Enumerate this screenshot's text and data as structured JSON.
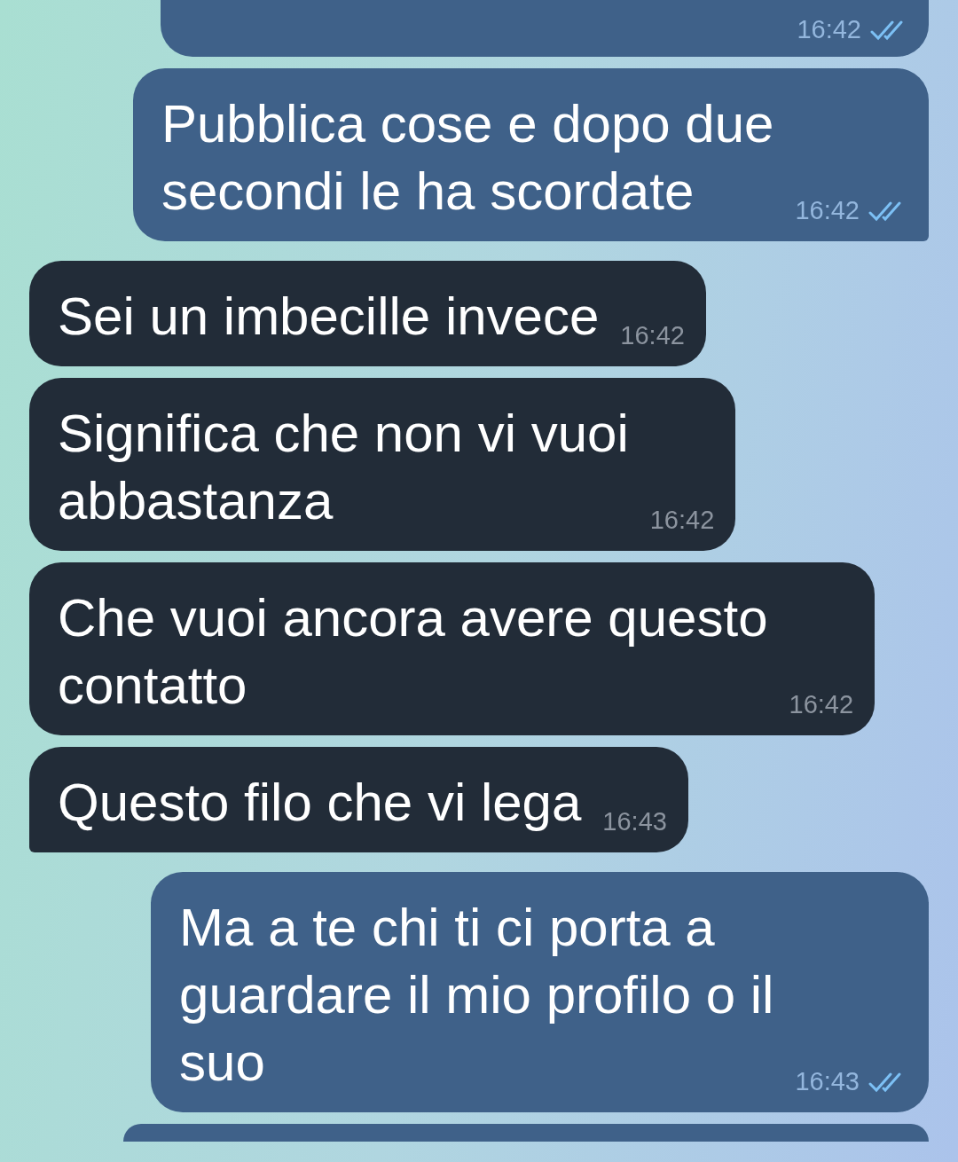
{
  "messages": [
    {
      "kind": "outgoing",
      "clipped_top": true,
      "time": "16:42",
      "read": true
    },
    {
      "kind": "outgoing",
      "lines": [
        "Pubblica cose e dopo due",
        "secondi le ha scordate"
      ],
      "time": "16:42",
      "read": true,
      "tail": true
    },
    {
      "kind": "incoming",
      "lines": [
        "Sei un imbecille invece"
      ],
      "time": "16:42"
    },
    {
      "kind": "incoming",
      "lines": [
        "Significa che non vi vuoi",
        "abbastanza"
      ],
      "time": "16:42"
    },
    {
      "kind": "incoming",
      "lines": [
        "Che vuoi ancora avere questo",
        "contatto"
      ],
      "time": "16:42"
    },
    {
      "kind": "incoming",
      "lines": [
        "Questo filo che vi lega"
      ],
      "time": "16:43",
      "tail": true
    },
    {
      "kind": "outgoing",
      "lines": [
        "Ma a te chi ti ci porta a",
        "guardare il mio profilo o il",
        "suo"
      ],
      "time": "16:43",
      "read": true
    },
    {
      "kind": "outgoing",
      "clipped_bottom": true
    }
  ]
}
